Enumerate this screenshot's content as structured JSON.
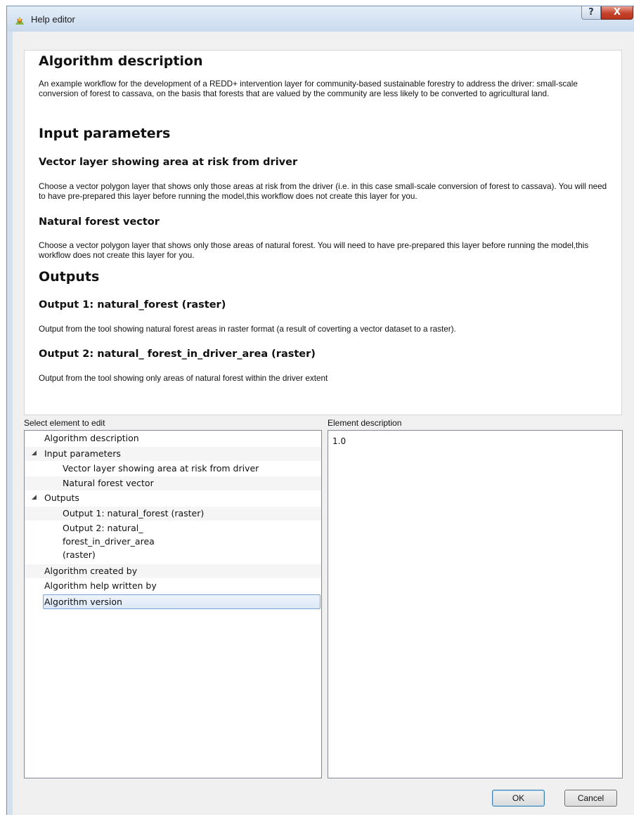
{
  "window": {
    "title": "Help editor",
    "help_glyph": "?",
    "close_glyph": "X",
    "app_icon": "qgis-processing-icon"
  },
  "preview": {
    "h_algo": "Algorithm description",
    "algo_text": "An example workflow for the development of a REDD+ intervention layer for community-based sustainable forestry to address the driver: small-scale conversion of forest to cassava, on the basis that forests that are valued by the community are less likely to be converted to agricultural land.",
    "h_inputs": "Input parameters",
    "h_vector": "Vector layer showing area at risk from driver",
    "vector_text": "Choose a vector polygon layer that shows only those areas at risk from the driver (i.e. in this case small-scale conversion of forest to cassava). You will need to have pre-prepared this layer before running the model,this workflow does not create this layer for you.",
    "h_natural": "Natural forest vector",
    "natural_text": "Choose a vector polygon layer that shows only those areas of natural forest. You will need to have pre-prepared this layer before running the model,this workflow does not create this layer for you.",
    "h_outputs": "Outputs",
    "h_out1": "Output 1: natural_forest (raster)",
    "out1_text": "Output from the tool showing natural forest areas in raster format (a result of coverting a vector dataset to a raster).",
    "h_out2": "Output 2: natural_ forest_in_driver_area (raster)",
    "out2_text": "Output from the tool showing only areas of natural forest within the driver extent"
  },
  "labels": {
    "select_element": "Select element to edit",
    "element_description": "Element description"
  },
  "tree": {
    "algorithm_description": "Algorithm description",
    "input_parameters": "Input parameters",
    "vector_layer": "Vector layer showing area at risk from driver",
    "natural_forest_vector": "Natural forest vector",
    "outputs": "Outputs",
    "output1": "Output 1: natural_forest (raster)",
    "output2_line1": "Output 2: natural_",
    "output2_line2": "forest_in_driver_area",
    "output2_line3": "(raster)",
    "created_by": "Algorithm created by",
    "help_written_by": "Algorithm help written by",
    "version": "Algorithm version",
    "expand_glyph": "◢"
  },
  "description_value": "1.0",
  "buttons": {
    "ok": "OK",
    "cancel": "Cancel"
  }
}
